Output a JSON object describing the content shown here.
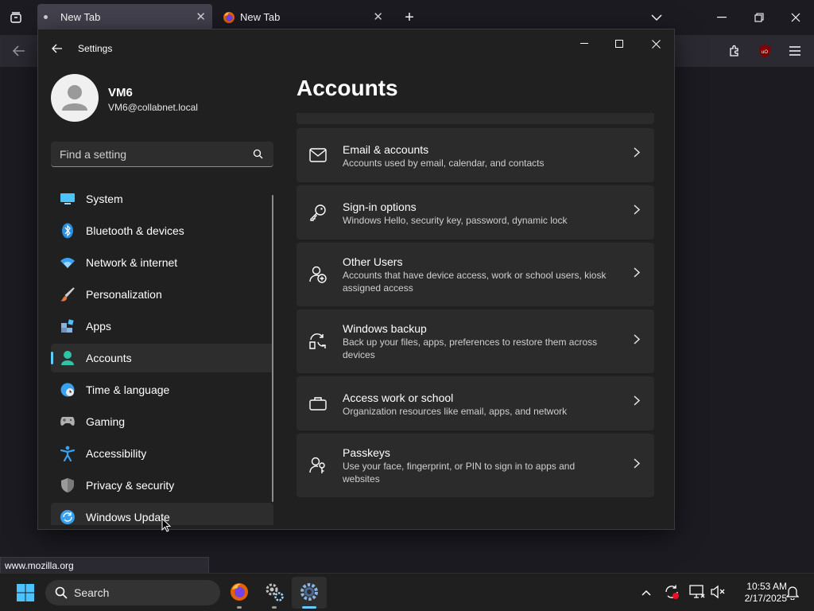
{
  "browser": {
    "tabs": [
      {
        "title": "New Tab",
        "active": true
      },
      {
        "title": "New Tab",
        "active": false
      }
    ],
    "status_url": "www.mozilla.org"
  },
  "settings": {
    "window_title": "Settings",
    "user": {
      "name": "VM6",
      "email": "VM6@collabnet.local"
    },
    "search_placeholder": "Find a setting",
    "nav": [
      {
        "label": "System",
        "icon": "monitor-icon",
        "color": "#4cc2ff"
      },
      {
        "label": "Bluetooth & devices",
        "icon": "bluetooth-icon",
        "color": "#2b8fe0"
      },
      {
        "label": "Network & internet",
        "icon": "wifi-icon",
        "color": "#3aa0f0"
      },
      {
        "label": "Personalization",
        "icon": "brush-icon",
        "color": "#e07a3a"
      },
      {
        "label": "Apps",
        "icon": "apps-icon",
        "color": "#8ab4e0"
      },
      {
        "label": "Accounts",
        "icon": "person-icon",
        "color": "#2ec4a6",
        "selected": true
      },
      {
        "label": "Time & language",
        "icon": "globe-clock-icon",
        "color": "#3aa0f0"
      },
      {
        "label": "Gaming",
        "icon": "gamepad-icon",
        "color": "#b0b0b0"
      },
      {
        "label": "Accessibility",
        "icon": "accessibility-icon",
        "color": "#3aa0f0"
      },
      {
        "label": "Privacy & security",
        "icon": "shield-icon",
        "color": "#9a9a9a"
      },
      {
        "label": "Windows Update",
        "icon": "update-icon",
        "color": "#3aa0f0"
      }
    ],
    "page_title": "Accounts",
    "cards": [
      {
        "title": "Email & accounts",
        "desc": "Accounts used by email, calendar, and contacts",
        "icon": "mail-icon"
      },
      {
        "title": "Sign-in options",
        "desc": "Windows Hello, security key, password, dynamic lock",
        "icon": "key-icon"
      },
      {
        "title": "Other Users",
        "desc": "Accounts that have device access, work or school users, kiosk assigned access",
        "icon": "add-user-icon"
      },
      {
        "title": "Windows backup",
        "desc": "Back up your files, apps, preferences to restore them across devices",
        "icon": "backup-icon"
      },
      {
        "title": "Access work or school",
        "desc": "Organization resources like email, apps, and network",
        "icon": "briefcase-icon"
      },
      {
        "title": "Passkeys",
        "desc": "Use your face, fingerprint, or PIN to sign in to apps and websites",
        "icon": "passkey-icon"
      }
    ]
  },
  "taskbar": {
    "search_label": "Search",
    "time": "10:53 AM",
    "date": "2/17/2025"
  }
}
